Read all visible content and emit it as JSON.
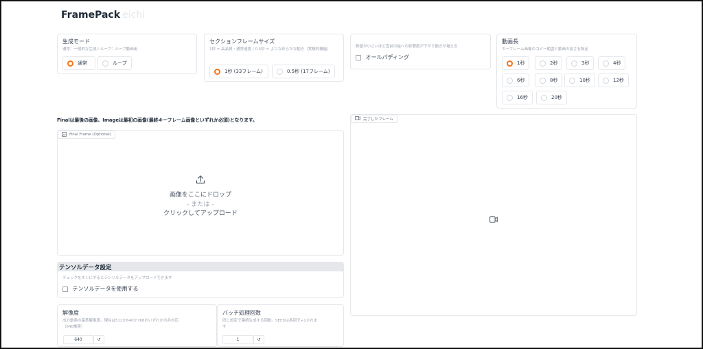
{
  "app": {
    "title": "FramePack",
    "title_suffix": "eichi"
  },
  "generation_mode": {
    "label": "生成モード",
    "info": "通常：一般的な生成 / ループ：ループ動画用",
    "options": [
      "通常",
      "ループ"
    ],
    "selected": "通常"
  },
  "section_frame_size": {
    "label": "セクションフレームサイズ",
    "info": "1秒 = 高品質・通常速度 / 0.5秒 = よりなめらかな動き（実験的機能）",
    "options": [
      "1秒 (33フレーム)",
      "0.5秒 (17フレーム)"
    ],
    "selected": "1秒 (33フレーム)"
  },
  "padding": {
    "info": "数値が小さいほど直前の絵への影響度が下がり動きが増える",
    "checkbox_label": "オールパディング",
    "checked": false
  },
  "video_length": {
    "label": "動画長",
    "info": "キーフレーム画像のコピー範囲と動画の長さを設定",
    "options": [
      "1秒",
      "2秒",
      "3秒",
      "4秒",
      "6秒",
      "8秒",
      "10秒",
      "12秒",
      "16秒",
      "20秒"
    ],
    "selected": "1秒"
  },
  "note": "Finalは最後の画像、Imageは最初の画像(最終キーフレーム画像といずれか必須)となります。",
  "final_frame": {
    "tag": "Final Frame (Optional)",
    "drop_text": "画像をここにドロップ",
    "or_text": "- または -",
    "click_text": "クリックしてアップロード"
  },
  "completed_frame": {
    "tag": "完了したフレーム"
  },
  "tensor": {
    "header": "テンソルデータ設定",
    "info": "チェックをオンにするとテンソルデータをアップロードできます",
    "checkbox_label": "テンソルデータを使用する",
    "checked": false
  },
  "resolution": {
    "label": "解像度",
    "info_line1": "出力動画の基準解像度。現在は512か640か768のいずれかのみ対応",
    "info_line2": "（640推奨）",
    "value": "640"
  },
  "batch": {
    "label": "バッチ処理回数",
    "info_line1": "同じ設定で連続生成する回数。SEEDは各回で+1されま",
    "info_line2": "す",
    "value": "1"
  },
  "icons": {
    "reset": "↺",
    "upload": "upload-icon",
    "video": "video-icon",
    "image": "image-icon"
  },
  "colors": {
    "accent": "#f97316",
    "border": "#e5e7eb",
    "header_bg": "#e5e7eb"
  }
}
